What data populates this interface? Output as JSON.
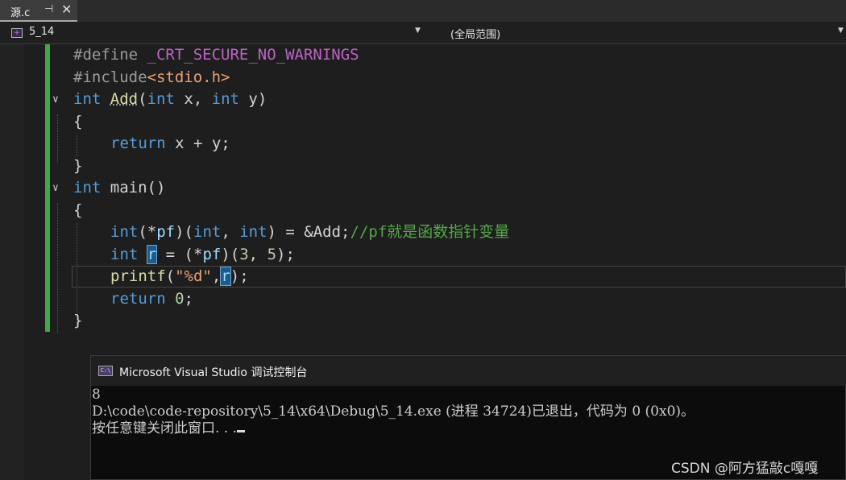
{
  "tab": {
    "filename": "源.c",
    "pin_icon": "pin-icon",
    "close_icon": "close-icon"
  },
  "nav": {
    "scope_left": "5_14",
    "scope_right": "(全局范围)"
  },
  "code_lines": {
    "l1": {
      "kw": "#define ",
      "macro": "_CRT_SECURE_NO_WARNINGS"
    },
    "l2": {
      "kw": "#include",
      "hdr": "<stdio.h>"
    },
    "l3": {
      "t1": "int",
      "fn": "Add",
      "p1": "(",
      "t2": "int",
      "x": " x, ",
      "t3": "int",
      "y": " y)"
    },
    "l4": "{",
    "l5": {
      "kw": "return",
      "rest": " x + y;"
    },
    "l6": "}",
    "l7": {
      "t1": "int",
      "rest": " main()"
    },
    "l8": "{",
    "l9": {
      "t1": "int",
      "a": "(*",
      "pf": "pf",
      "b": ")(",
      "t2": "int",
      "c": ", ",
      "t3": "int",
      "d": ") = &Add;",
      "comment": "//pf就是函数指针变量"
    },
    "l10": {
      "t1": "int",
      "sp": " ",
      "r": "r",
      "a": " = (*",
      "pf": "pf",
      "b": ")(",
      "n1": "3",
      "c": ", ",
      "n2": "5",
      "d": ");"
    },
    "l11": {
      "fn": "printf",
      "a": "(",
      "str": "\"%d\"",
      "b": ",",
      "r": "r",
      "c": ");"
    },
    "l12": {
      "kw": "return",
      "sp": " ",
      "n": "0",
      "semi": ";"
    },
    "l13": "}"
  },
  "console": {
    "title": "Microsoft Visual Studio 调试控制台",
    "line1": "8",
    "line2": "D:\\code\\code-repository\\5_14\\x64\\Debug\\5_14.exe (进程 34724)已退出，代码为 0 (0x0)。",
    "line3": "按任意键关闭此窗口. . ."
  },
  "watermark": "CSDN @阿方猛敲c嘎嘎"
}
